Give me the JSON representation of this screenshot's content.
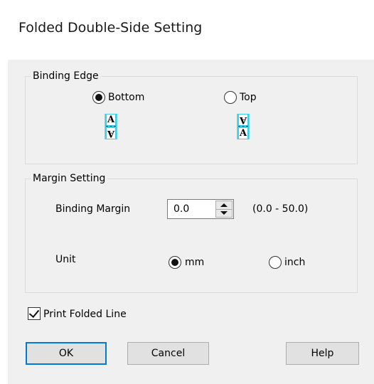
{
  "window": {
    "title": "Folded Double-Side Setting"
  },
  "binding_edge": {
    "group_label": "Binding Edge",
    "options": [
      {
        "label": "Bottom",
        "selected": true
      },
      {
        "label": "Top",
        "selected": false
      }
    ],
    "icon_letter": "A"
  },
  "margin_setting": {
    "group_label": "Margin Setting",
    "binding_margin_label": "Binding Margin",
    "binding_margin_value": "0.0",
    "binding_margin_range": "(0.0 - 50.0)",
    "unit_label": "Unit",
    "units": [
      {
        "label": "mm",
        "selected": true
      },
      {
        "label": "inch",
        "selected": false
      }
    ]
  },
  "print_folded_line": {
    "label": "Print Folded Line",
    "checked": true
  },
  "buttons": {
    "ok": "OK",
    "cancel": "Cancel",
    "help": "Help"
  },
  "colors": {
    "accent": "#0078d7",
    "page_icon": "#3ccfe6"
  }
}
